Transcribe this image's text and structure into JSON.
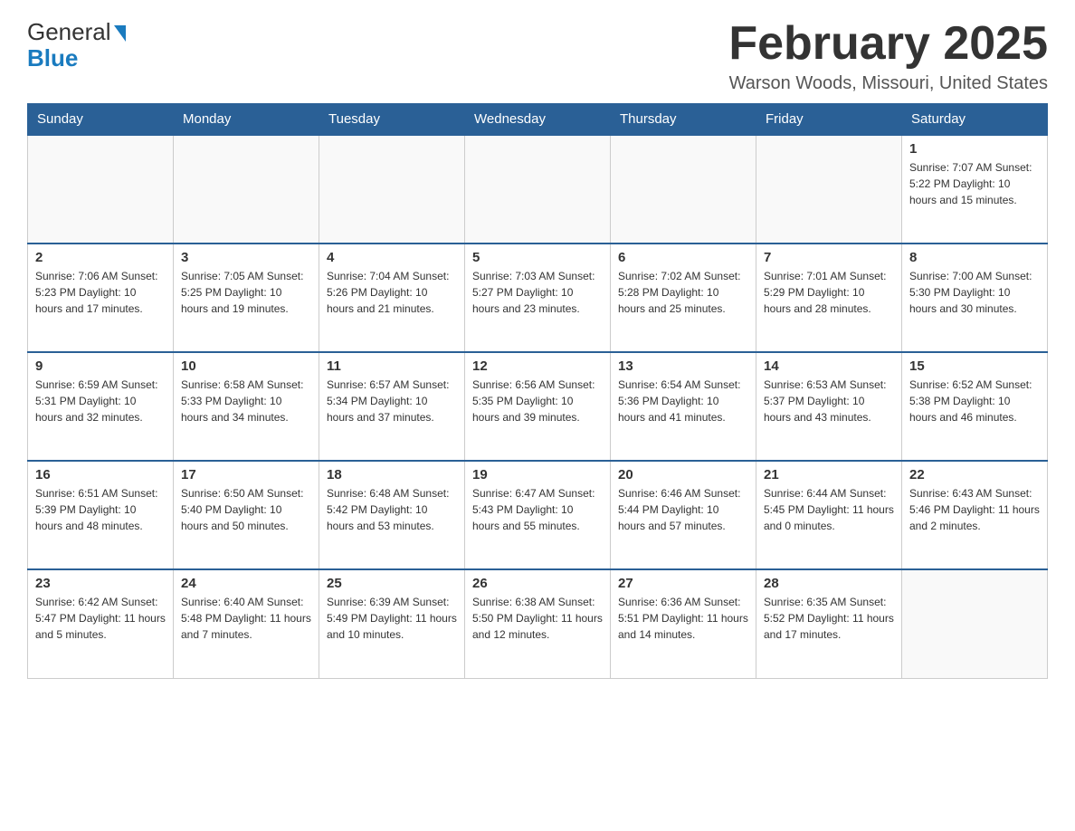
{
  "header": {
    "logo_general": "General",
    "logo_blue": "Blue",
    "month_title": "February 2025",
    "location": "Warson Woods, Missouri, United States"
  },
  "weekdays": [
    "Sunday",
    "Monday",
    "Tuesday",
    "Wednesday",
    "Thursday",
    "Friday",
    "Saturday"
  ],
  "weeks": [
    [
      {
        "day": "",
        "info": ""
      },
      {
        "day": "",
        "info": ""
      },
      {
        "day": "",
        "info": ""
      },
      {
        "day": "",
        "info": ""
      },
      {
        "day": "",
        "info": ""
      },
      {
        "day": "",
        "info": ""
      },
      {
        "day": "1",
        "info": "Sunrise: 7:07 AM\nSunset: 5:22 PM\nDaylight: 10 hours and 15 minutes."
      }
    ],
    [
      {
        "day": "2",
        "info": "Sunrise: 7:06 AM\nSunset: 5:23 PM\nDaylight: 10 hours and 17 minutes."
      },
      {
        "day": "3",
        "info": "Sunrise: 7:05 AM\nSunset: 5:25 PM\nDaylight: 10 hours and 19 minutes."
      },
      {
        "day": "4",
        "info": "Sunrise: 7:04 AM\nSunset: 5:26 PM\nDaylight: 10 hours and 21 minutes."
      },
      {
        "day": "5",
        "info": "Sunrise: 7:03 AM\nSunset: 5:27 PM\nDaylight: 10 hours and 23 minutes."
      },
      {
        "day": "6",
        "info": "Sunrise: 7:02 AM\nSunset: 5:28 PM\nDaylight: 10 hours and 25 minutes."
      },
      {
        "day": "7",
        "info": "Sunrise: 7:01 AM\nSunset: 5:29 PM\nDaylight: 10 hours and 28 minutes."
      },
      {
        "day": "8",
        "info": "Sunrise: 7:00 AM\nSunset: 5:30 PM\nDaylight: 10 hours and 30 minutes."
      }
    ],
    [
      {
        "day": "9",
        "info": "Sunrise: 6:59 AM\nSunset: 5:31 PM\nDaylight: 10 hours and 32 minutes."
      },
      {
        "day": "10",
        "info": "Sunrise: 6:58 AM\nSunset: 5:33 PM\nDaylight: 10 hours and 34 minutes."
      },
      {
        "day": "11",
        "info": "Sunrise: 6:57 AM\nSunset: 5:34 PM\nDaylight: 10 hours and 37 minutes."
      },
      {
        "day": "12",
        "info": "Sunrise: 6:56 AM\nSunset: 5:35 PM\nDaylight: 10 hours and 39 minutes."
      },
      {
        "day": "13",
        "info": "Sunrise: 6:54 AM\nSunset: 5:36 PM\nDaylight: 10 hours and 41 minutes."
      },
      {
        "day": "14",
        "info": "Sunrise: 6:53 AM\nSunset: 5:37 PM\nDaylight: 10 hours and 43 minutes."
      },
      {
        "day": "15",
        "info": "Sunrise: 6:52 AM\nSunset: 5:38 PM\nDaylight: 10 hours and 46 minutes."
      }
    ],
    [
      {
        "day": "16",
        "info": "Sunrise: 6:51 AM\nSunset: 5:39 PM\nDaylight: 10 hours and 48 minutes."
      },
      {
        "day": "17",
        "info": "Sunrise: 6:50 AM\nSunset: 5:40 PM\nDaylight: 10 hours and 50 minutes."
      },
      {
        "day": "18",
        "info": "Sunrise: 6:48 AM\nSunset: 5:42 PM\nDaylight: 10 hours and 53 minutes."
      },
      {
        "day": "19",
        "info": "Sunrise: 6:47 AM\nSunset: 5:43 PM\nDaylight: 10 hours and 55 minutes."
      },
      {
        "day": "20",
        "info": "Sunrise: 6:46 AM\nSunset: 5:44 PM\nDaylight: 10 hours and 57 minutes."
      },
      {
        "day": "21",
        "info": "Sunrise: 6:44 AM\nSunset: 5:45 PM\nDaylight: 11 hours and 0 minutes."
      },
      {
        "day": "22",
        "info": "Sunrise: 6:43 AM\nSunset: 5:46 PM\nDaylight: 11 hours and 2 minutes."
      }
    ],
    [
      {
        "day": "23",
        "info": "Sunrise: 6:42 AM\nSunset: 5:47 PM\nDaylight: 11 hours and 5 minutes."
      },
      {
        "day": "24",
        "info": "Sunrise: 6:40 AM\nSunset: 5:48 PM\nDaylight: 11 hours and 7 minutes."
      },
      {
        "day": "25",
        "info": "Sunrise: 6:39 AM\nSunset: 5:49 PM\nDaylight: 11 hours and 10 minutes."
      },
      {
        "day": "26",
        "info": "Sunrise: 6:38 AM\nSunset: 5:50 PM\nDaylight: 11 hours and 12 minutes."
      },
      {
        "day": "27",
        "info": "Sunrise: 6:36 AM\nSunset: 5:51 PM\nDaylight: 11 hours and 14 minutes."
      },
      {
        "day": "28",
        "info": "Sunrise: 6:35 AM\nSunset: 5:52 PM\nDaylight: 11 hours and 17 minutes."
      },
      {
        "day": "",
        "info": ""
      }
    ]
  ]
}
